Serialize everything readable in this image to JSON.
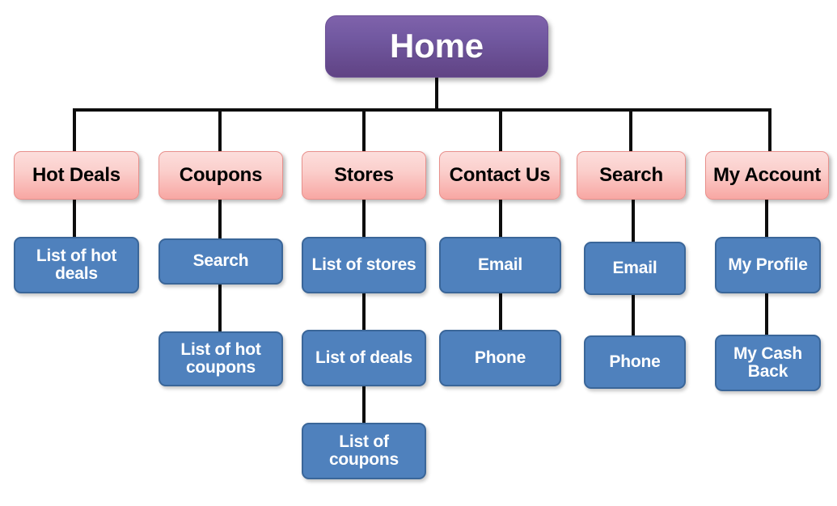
{
  "diagram": {
    "type": "sitemap-tree",
    "title_node": "Home",
    "colors": {
      "root_fill_top": "#7f62ab",
      "root_fill_bottom": "#604384",
      "level1_fill_top": "#fcdedc",
      "level1_fill_bottom": "#f8a7a3",
      "level1_border": "#e8908c",
      "level2_fill": "#4f81bd",
      "level2_border": "#3a6699",
      "connector": "#0d0d0d",
      "background": "#ffffff"
    },
    "root": {
      "label": "Home"
    },
    "branches": [
      {
        "id": "hot-deals",
        "label": "Hot Deals",
        "children": [
          {
            "id": "list-of-hot-deals",
            "label": "List of hot deals"
          }
        ]
      },
      {
        "id": "coupons",
        "label": "Coupons",
        "children": [
          {
            "id": "coupons-search",
            "label": "Search"
          },
          {
            "id": "list-of-hot-coupons",
            "label": "List of hot coupons"
          }
        ]
      },
      {
        "id": "stores",
        "label": "Stores",
        "children": [
          {
            "id": "list-of-stores",
            "label": "List of stores"
          },
          {
            "id": "list-of-deals",
            "label": "List of deals"
          },
          {
            "id": "list-of-coupons",
            "label": "List of coupons"
          }
        ]
      },
      {
        "id": "contact-us",
        "label": "Contact Us",
        "children": [
          {
            "id": "contact-email",
            "label": "Email"
          },
          {
            "id": "contact-phone",
            "label": "Phone"
          }
        ]
      },
      {
        "id": "search",
        "label": "Search",
        "children": [
          {
            "id": "search-email",
            "label": "Email"
          },
          {
            "id": "search-phone",
            "label": "Phone"
          }
        ]
      },
      {
        "id": "my-account",
        "label": "My Account",
        "children": [
          {
            "id": "my-profile",
            "label": "My Profile"
          },
          {
            "id": "my-cash-back",
            "label": "My Cash Back"
          }
        ]
      }
    ]
  }
}
